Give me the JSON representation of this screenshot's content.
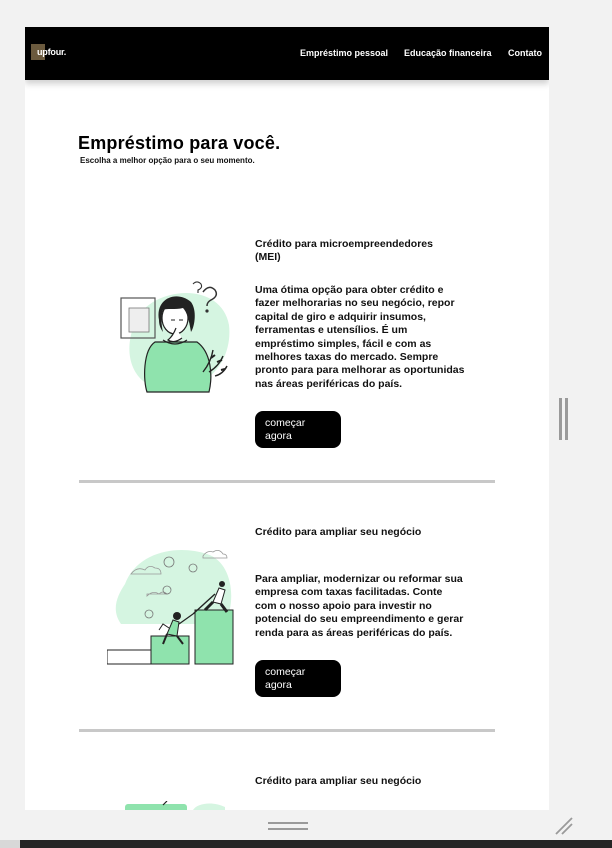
{
  "navbar": {
    "logo_text": "upfour.",
    "links": [
      "Empréstimo pessoal",
      "Educação financeira",
      "Contato"
    ]
  },
  "hero": {
    "title": "Empréstimo para você.",
    "subtitle": "Escolha a melhor opção para o seu momento."
  },
  "cards": [
    {
      "title": "Crédito para microempreendedores (MEI)",
      "description": "Uma ótima opção para obter crédito e fazer melhorarias no seu negócio, repor capital de giro e adquirir insumos, ferramentas e utensílios. É um empréstimo simples, fácil e com as melhores taxas do mercado. Sempre pronto para para melhorar as oportunidas nas áreas periféricas do país.",
      "button": "começar agora",
      "illustration": "woman-thinking-illustration"
    },
    {
      "title": "Crédito para ampliar seu negócio",
      "description": "Para ampliar, modernizar ou reformar sua empresa com taxas facilitadas. Conte com o nosso apoio para investir no potencial do seu empreendimento e gerar renda para as áreas periféricas do país.",
      "button": "começar agora",
      "illustration": "people-climbing-steps-illustration"
    },
    {
      "title": "Crédito para ampliar seu negócio",
      "illustration": "laptop-illustration"
    }
  ],
  "colors": {
    "accent_green": "#8fe3ad",
    "light_green": "#d5f5e1",
    "navbar_bg": "#000000",
    "divider": "#c8c8c8"
  },
  "chrome": {
    "scroll_handle_icon": "scroll-handle-icon",
    "resize_icon": "resize-corner-icon"
  }
}
